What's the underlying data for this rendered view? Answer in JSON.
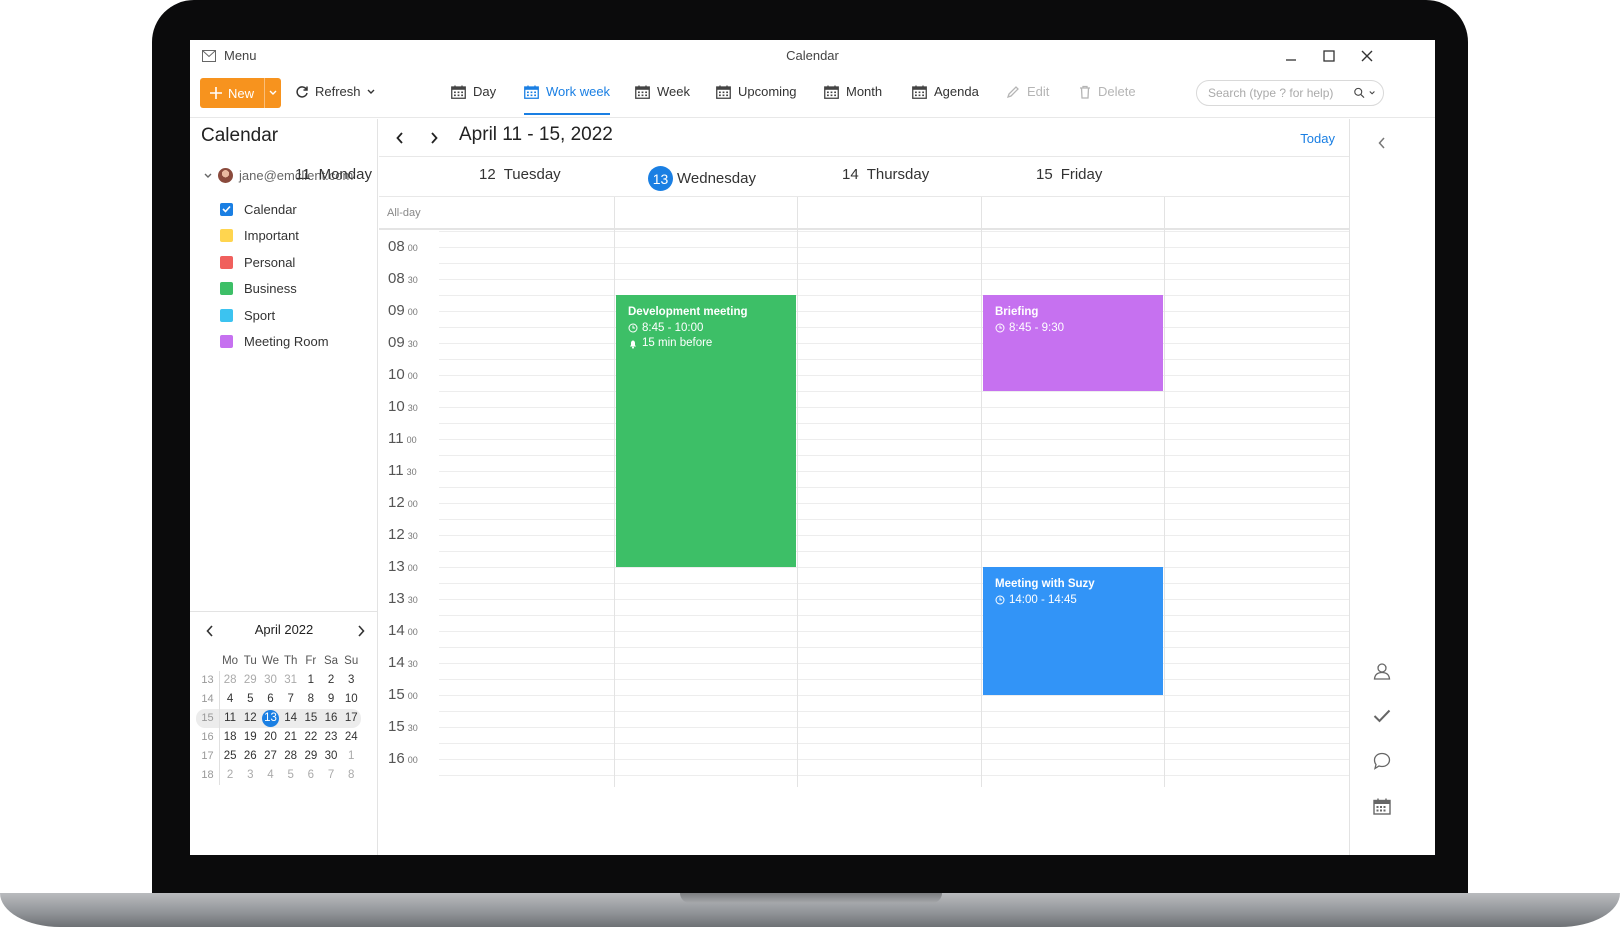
{
  "window": {
    "menu_label": "Menu",
    "title": "Calendar"
  },
  "toolbar": {
    "new_label": "New",
    "refresh_label": "Refresh",
    "views": [
      {
        "label": "Day",
        "icon": "calendar-icon"
      },
      {
        "label": "Work week",
        "icon": "calendar-icon",
        "active": true
      },
      {
        "label": "Week",
        "icon": "calendar-icon"
      },
      {
        "label": "Upcoming",
        "icon": "calendar-icon"
      },
      {
        "label": "Month",
        "icon": "calendar-icon"
      },
      {
        "label": "Agenda",
        "icon": "calendar-icon"
      }
    ],
    "edit_label": "Edit",
    "delete_label": "Delete",
    "search_placeholder": "Search (type ? for help)"
  },
  "sidebar": {
    "title": "Calendar",
    "account": "jane@emclient.com",
    "calendars": [
      {
        "label": "Calendar",
        "color": "#1a7fe3",
        "checked": true
      },
      {
        "label": "Important",
        "color": "#ffd54f"
      },
      {
        "label": "Personal",
        "color": "#f0605d"
      },
      {
        "label": "Business",
        "color": "#3dbf67"
      },
      {
        "label": "Sport",
        "color": "#3cc3f0"
      },
      {
        "label": "Meeting Room",
        "color": "#c671f0"
      }
    ]
  },
  "mini_calendar": {
    "month_label": "April 2022",
    "weekdays": [
      "Mo",
      "Tu",
      "We",
      "Th",
      "Fr",
      "Sa",
      "Su"
    ],
    "weeks": [
      {
        "wk": "13",
        "days": [
          "28",
          "29",
          "30",
          "31",
          "1",
          "2",
          "3"
        ]
      },
      {
        "wk": "14",
        "days": [
          "4",
          "5",
          "6",
          "7",
          "8",
          "9",
          "10"
        ]
      },
      {
        "wk": "15",
        "days": [
          "11",
          "12",
          "13",
          "14",
          "15",
          "16",
          "17"
        ]
      },
      {
        "wk": "16",
        "days": [
          "18",
          "19",
          "20",
          "21",
          "22",
          "23",
          "24"
        ]
      },
      {
        "wk": "17",
        "days": [
          "25",
          "26",
          "27",
          "28",
          "29",
          "30",
          "1"
        ]
      },
      {
        "wk": "18",
        "days": [
          "2",
          "3",
          "4",
          "5",
          "6",
          "7",
          "8"
        ]
      }
    ],
    "today": "13"
  },
  "calendar_view": {
    "range_title": "April 11 - 15, 2022",
    "today_label": "Today",
    "all_day_label": "All-day",
    "days": [
      {
        "num": "11",
        "name": "Monday"
      },
      {
        "num": "12",
        "name": "Tuesday"
      },
      {
        "num": "13",
        "name": "Wednesday",
        "today": true
      },
      {
        "num": "14",
        "name": "Thursday"
      },
      {
        "num": "15",
        "name": "Friday"
      }
    ],
    "time_slots": [
      {
        "h": "08",
        "m": "00"
      },
      {
        "h": "08",
        "m": "30"
      },
      {
        "h": "09",
        "m": "00"
      },
      {
        "h": "09",
        "m": "30"
      },
      {
        "h": "10",
        "m": "00"
      },
      {
        "h": "10",
        "m": "30"
      },
      {
        "h": "11",
        "m": "00"
      },
      {
        "h": "11",
        "m": "30"
      },
      {
        "h": "12",
        "m": "00"
      },
      {
        "h": "12",
        "m": "30"
      },
      {
        "h": "13",
        "m": "00"
      },
      {
        "h": "13",
        "m": "30"
      },
      {
        "h": "14",
        "m": "00"
      },
      {
        "h": "14",
        "m": "30"
      },
      {
        "h": "15",
        "m": "00"
      },
      {
        "h": "15",
        "m": "30"
      },
      {
        "h": "16",
        "m": "00"
      }
    ],
    "events": [
      {
        "title": "Development meeting",
        "time": "8:45 - 10:00",
        "reminder": "15 min before",
        "day_index": 1,
        "start": 8.75,
        "end": 13.0,
        "color": "#3dbf67"
      },
      {
        "title": "Briefing",
        "time": "8:45 - 9:30",
        "day_index": 3,
        "start": 8.75,
        "end": 10.25,
        "color": "#c671f0"
      },
      {
        "title": "Meeting with Suzy",
        "time": "14:00 - 14:45",
        "day_index": 3,
        "start": 13.0,
        "end": 15.0,
        "color": "#3294f7"
      }
    ]
  }
}
